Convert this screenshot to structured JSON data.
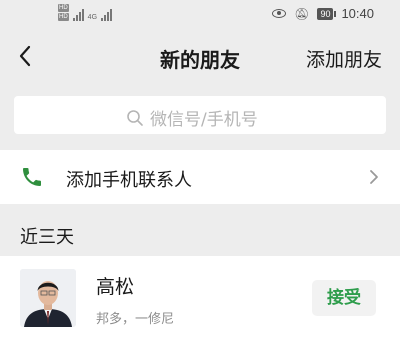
{
  "status_bar": {
    "hd_left_top": "HD",
    "hd_left_bottom": "HD",
    "network": "4G",
    "battery": "90",
    "time": "10:40"
  },
  "nav": {
    "title": "新的朋友",
    "action_label": "添加朋友"
  },
  "search": {
    "placeholder": "微信号/手机号"
  },
  "add_phone_contacts": {
    "label": "添加手机联系人"
  },
  "section": {
    "title": "近三天"
  },
  "contacts": [
    {
      "name": "高松",
      "message": "邦多，一修尼",
      "action_label": "接受"
    }
  ],
  "colors": {
    "background": "#ededed",
    "accent_green": "#2e9d4c",
    "phone_icon_green": "#2f8f3e"
  },
  "icons": {
    "back": "chevron-left-icon",
    "search": "search-icon",
    "phone": "phone-icon",
    "chevron": "chevron-right-icon"
  }
}
